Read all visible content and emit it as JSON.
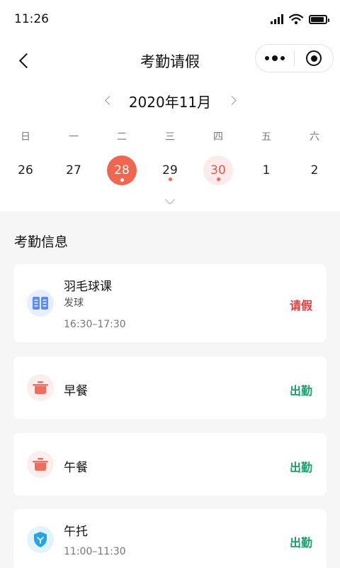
{
  "status_bar": {
    "time": "11:26"
  },
  "nav": {
    "title": "考勤请假"
  },
  "calendar": {
    "month": "2020年11月",
    "weekdays": [
      "日",
      "一",
      "二",
      "三",
      "四",
      "五",
      "六"
    ],
    "days": [
      {
        "num": "26",
        "state": "normal",
        "dot": false
      },
      {
        "num": "27",
        "state": "normal",
        "dot": false
      },
      {
        "num": "28",
        "state": "selected",
        "dot": true
      },
      {
        "num": "29",
        "state": "normal",
        "dot": true
      },
      {
        "num": "30",
        "state": "today",
        "dot": true
      },
      {
        "num": "1",
        "state": "normal",
        "dot": false
      },
      {
        "num": "2",
        "state": "normal",
        "dot": false
      }
    ]
  },
  "section": {
    "title": "考勤信息"
  },
  "records": [
    {
      "title": "羽毛球课",
      "subtitle": "发球",
      "time": "16:30–17:30",
      "status": "请假",
      "status_type": "leave",
      "icon": "book-icon"
    },
    {
      "title": "早餐",
      "subtitle": "",
      "time": "",
      "status": "出勤",
      "status_type": "present",
      "icon": "pot-icon"
    },
    {
      "title": "午餐",
      "subtitle": "",
      "time": "",
      "status": "出勤",
      "status_type": "present",
      "icon": "pot-icon"
    },
    {
      "title": "午托",
      "subtitle": "",
      "time": "11:00–11:30",
      "status": "出勤",
      "status_type": "present",
      "icon": "shield-icon"
    }
  ],
  "colors": {
    "accent": "#f0664f",
    "today_bg": "#fdeaea",
    "leave": "#e43c3c",
    "present": "#1aa06b",
    "book_icon": "#5b8cf5",
    "pot_icon": "#ef6d5e",
    "shield_icon": "#2aa4e0"
  }
}
